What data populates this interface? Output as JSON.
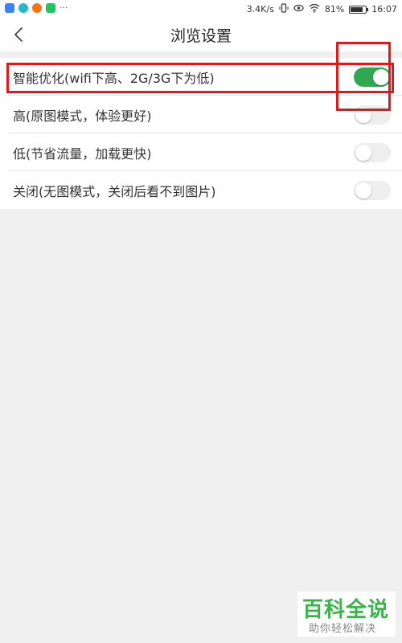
{
  "status_bar": {
    "network_speed": "3.4K/s",
    "battery_percent": "81%",
    "battery_level": 0.81,
    "time": "16:07",
    "overflow": "···",
    "app_icon_colors": [
      "#3b82f6",
      "#22b8cf",
      "#f97316",
      "#22c55e"
    ]
  },
  "header": {
    "title": "浏览设置",
    "back_icon": "chevron-left-icon"
  },
  "settings": [
    {
      "label": "智能优化(wifi下高、2G/3G下为低)",
      "enabled": true
    },
    {
      "label": "高(原图模式，体验更好)",
      "enabled": false
    },
    {
      "label": "低(节省流量，加载更快)",
      "enabled": false
    },
    {
      "label": "关闭(无图模式，关闭后看不到图片)",
      "enabled": false
    }
  ],
  "colors": {
    "toggle_on": "#2fa84f",
    "toggle_off": "#eeeeee",
    "annotation": "#e0191b",
    "watermark": "#39b34a"
  },
  "watermark": {
    "main": "百科全说",
    "sub": "助你轻松解决"
  }
}
